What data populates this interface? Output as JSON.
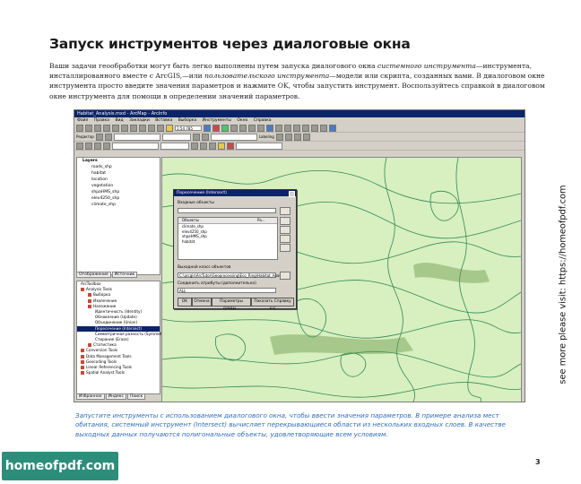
{
  "heading": "Запуск инструментов через диалоговые окна",
  "intro": {
    "p1": "Ваши задачи геообработки могут быть легко выполнены путем запуска диалогового окна ",
    "i1": "системного инструмента",
    "p2": "—инструмента, инсталлированного вместе с ArcGIS,—или ",
    "i2": "пользовательского инструмента",
    "p3": "—модели или скрипта, созданных вами. В диалоговом окне инструмента просто введите значения параметров и нажмите OK, чтобы запустить инструмент. Воспользуйтесь справкой в диалоговом окне инструмента для помощи в определении значений параметров."
  },
  "screenshot": {
    "window_title": "Habitat_Analysis.mxd - ArcMap - ArcInfo",
    "menu": [
      "Файл",
      "Правка",
      "Вид",
      "Закладки",
      "Вставка",
      "Выборка",
      "Инструменты",
      "Окно",
      "Справка"
    ],
    "scale": "1:54 785",
    "editor_label": "Редактор",
    "labeling_label": "Labeling",
    "toc": {
      "root": "Layers",
      "layers": [
        "roads_shp",
        "habitat",
        "location",
        "vegetation",
        "shpaHMS_shp",
        "elev4250_shp",
        "climate_shp"
      ]
    },
    "toc_tabs": [
      "Отображение",
      "Источник"
    ],
    "toolbox": {
      "root": "ArcToolbox",
      "items": [
        {
          "level": 1,
          "label": "Analysis Tools"
        },
        {
          "level": 2,
          "label": "Выборка"
        },
        {
          "level": 2,
          "label": "Извлечение"
        },
        {
          "level": 2,
          "label": "Наложение"
        },
        {
          "level": 3,
          "label": "Идентичность (Identity)"
        },
        {
          "level": 3,
          "label": "Обновление (Update)"
        },
        {
          "level": 3,
          "label": "Объединение (Union)"
        },
        {
          "level": 3,
          "label": "Пересечение (Intersect)",
          "selected": true
        },
        {
          "level": 3,
          "label": "Симметричная разность (Symmetrical D"
        },
        {
          "level": 3,
          "label": "Стирание (Erase)"
        },
        {
          "level": 2,
          "label": "Статистика"
        },
        {
          "level": 1,
          "label": "Conversion Tools"
        },
        {
          "level": 1,
          "label": "Data Management Tools"
        },
        {
          "level": 1,
          "label": "Geocoding Tools"
        },
        {
          "level": 1,
          "label": "Linear Referencing Tools"
        },
        {
          "level": 1,
          "label": "Spatial Analyst Tools"
        }
      ]
    },
    "bottom_tabs": [
      "Избранное",
      "Индекс",
      "Поиск"
    ],
    "dialog": {
      "title": "Пересечение (Intersect)",
      "input_label": "Входные объекты",
      "list_header": "Объекты",
      "list_rank": "Ра...",
      "list_items": [
        "climate_shp",
        "elev4250_shp",
        "shpaHMS_shp",
        "habitat"
      ],
      "output_label": "Выходной класс объектов",
      "output_value": "C:\\arcgis\\ArcTutor\\Geoprocessing\\Eco_Ring\\Habitat_Analy",
      "join_label": "Соединить атрибуты (дополнительно)",
      "join_value": "ALL",
      "buttons": [
        "OK",
        "Отмена",
        "Параметры среды...",
        "Показать Справку <<"
      ]
    }
  },
  "caption": "Запустите инструменты с использованием диалогового окна, чтобы ввести значения параметров. В примере анализа мест обитания, системный инструмент (Intersect) вычисляет перекрывающиеся области из нескольких входных слоев. В качестве выходных данных получаются полигональные объекты, удовлетворяющие всем условиям.",
  "side_note": "see more please visit: https://homeofpdf.com",
  "logo_text": "homeofpdf.com",
  "page_number": "3",
  "colors": {
    "caption": "#2f6cc0",
    "map_fill": "#d8efc0",
    "contours": "#2e8b57",
    "logo_bg": "#2c8e7a"
  }
}
